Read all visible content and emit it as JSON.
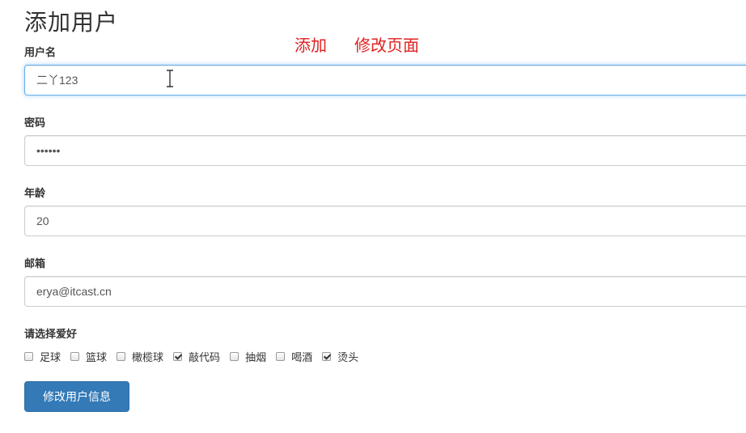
{
  "page": {
    "title": "添加用户"
  },
  "annotations": {
    "add": "添加",
    "edit": "修改页面"
  },
  "form": {
    "username": {
      "label": "用户名",
      "value": "二丫123"
    },
    "password": {
      "label": "密码",
      "value": "••••••"
    },
    "age": {
      "label": "年龄",
      "value": "20"
    },
    "email": {
      "label": "邮箱",
      "value": "erya@itcast.cn"
    },
    "hobbies": {
      "label": "请选择爱好",
      "options": [
        {
          "label": "足球",
          "checked": false
        },
        {
          "label": "篮球",
          "checked": false
        },
        {
          "label": "橄榄球",
          "checked": false
        },
        {
          "label": "敲代码",
          "checked": true
        },
        {
          "label": "抽烟",
          "checked": false
        },
        {
          "label": "喝酒",
          "checked": false
        },
        {
          "label": "烫头",
          "checked": true
        }
      ]
    },
    "submit_label": "修改用户信息"
  },
  "colors": {
    "primary": "#337ab7",
    "annotation": "#e02020",
    "focus": "#66afe9"
  },
  "icons": {
    "cursor": "text-cursor-icon"
  }
}
